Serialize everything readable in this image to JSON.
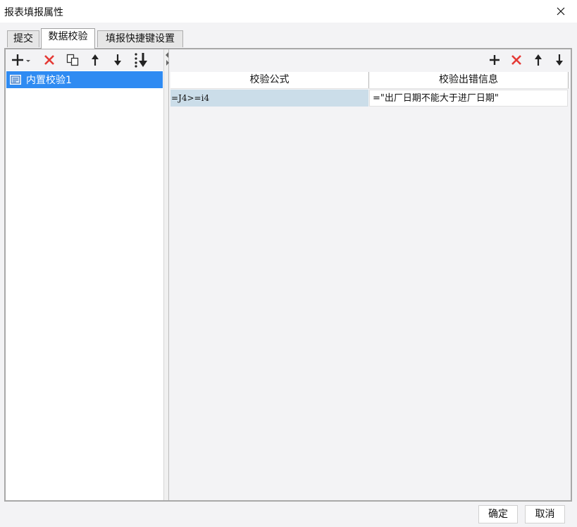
{
  "window": {
    "title": "报表填报属性"
  },
  "tabs": [
    {
      "label": "提交"
    },
    {
      "label": "数据校验"
    },
    {
      "label": "填报快捷键设置"
    }
  ],
  "active_tab": "数据校验",
  "left_toolbar": {
    "icons": [
      "add-dropdown-icon",
      "delete-icon",
      "copy-icon",
      "move-up-icon",
      "move-down-icon",
      "move-to-bottom-icon"
    ]
  },
  "tree": {
    "items": [
      {
        "label": "内置校验1",
        "selected": true,
        "icon": "validation-item-icon"
      }
    ]
  },
  "right_toolbar": {
    "icons": [
      "add-icon",
      "delete-icon",
      "move-up-icon",
      "move-down-icon"
    ]
  },
  "grid": {
    "columns": [
      "校验公式",
      "校验出错信息"
    ],
    "rows": [
      {
        "formula": "=J4>=i4",
        "message": "=\"出厂日期不能大于进厂日期\""
      }
    ]
  },
  "footer": {
    "ok_label": "确定",
    "cancel_label": "取消"
  },
  "colors": {
    "selection": "#2f8bf2",
    "row_highlight": "#cbdde9",
    "delete_red": "#e53935"
  }
}
